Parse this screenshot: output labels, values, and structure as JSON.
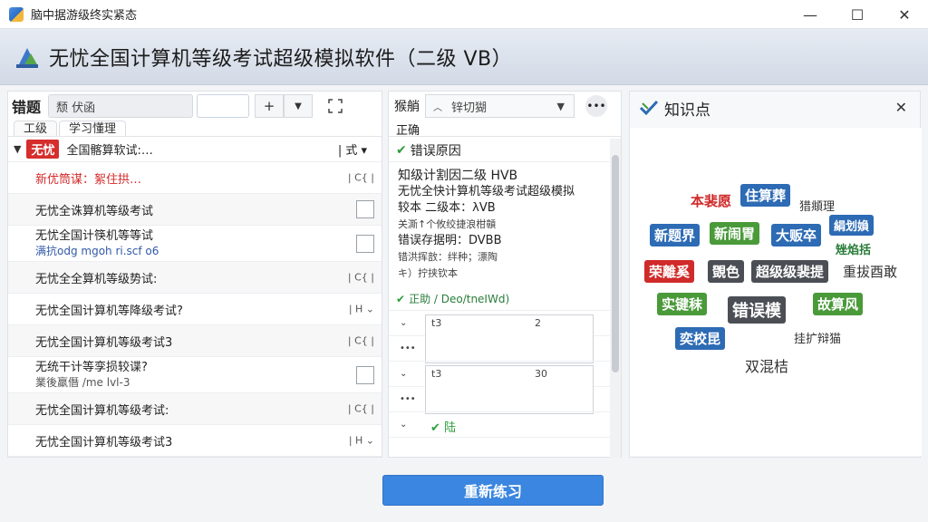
{
  "window": {
    "title": "脑中据游级终实紧态",
    "minimize": "—",
    "maximize": "☐",
    "close": "✕"
  },
  "banner": {
    "title": "无忧全国计算机等级考试超级模拟软件（二级 VB）"
  },
  "left": {
    "title": "错题",
    "status": "颓  伏函",
    "add": "+",
    "dropdown": "▼",
    "tabs": [
      "工级",
      "学习懂理"
    ],
    "group": {
      "badge": "无忧",
      "label": "全国髂算软试:…",
      "ctrl": "| 式 ▾"
    },
    "rows": [
      {
        "label": "新优筒谋：絮住拱…",
        "ctrl": "| C{ |"
      },
      {
        "label": "无忧全诛算机等级考试"
      },
      {
        "label": "无忧全国计筷机等等试",
        "sub": "满抗odg mgoh ri.scf o6"
      },
      {
        "label": "无忧全全算机等级势试:",
        "ctrl": "| C{ |"
      },
      {
        "label": "无忧全国计算机等降级考试?",
        "ctrl": "| H ⌄"
      },
      {
        "label": "无忧全国计算机等级考试3",
        "ctrl": "| C{ |"
      },
      {
        "label": "无统干计等孪损较谍?",
        "sub": "業後羸僭 /me lvl-3"
      },
      {
        "label": "无忧全国计算机等级考试:",
        "ctrl": "| C{ |"
      },
      {
        "label": "无忧全国计算机等级考试3",
        "ctrl": "| H ⌄"
      }
    ]
  },
  "middle": {
    "title": "猴艄",
    "select": "锌切猢",
    "sub": "正确",
    "heading": "错误原因",
    "lines": [
      "知级计割因二级 HVB",
      "无忧全快计算机等级考试超级模拟",
      "较本 二级本：λVB",
      "关澌↑个攸绞捷浪柑贑",
      "错误存据明：DVBB",
      "错洪挥敨：绊种；漂陶",
      "キ）拧挟钦本"
    ],
    "ok": "正助 /  Deo/tneIWd)",
    "rows": [
      {
        "a": "⌄",
        "t1": "t3",
        "t2": "2"
      },
      {
        "a": "•••",
        "t1": "",
        "t2": ""
      },
      {
        "a": "⌄",
        "t1": "t3",
        "t2": "30"
      },
      {
        "a": "•••",
        "t1": "",
        "t2": ""
      },
      {
        "a": "⌄",
        "t1": "✔ 陆",
        "t2": ""
      }
    ]
  },
  "right": {
    "title": "知识点",
    "close": "✕",
    "tags": [
      {
        "text": "本裴愿",
        "style": "plain-red"
      },
      {
        "text": "住算葬",
        "style": "blue"
      },
      {
        "text": "猎頫理",
        "style": "plain"
      },
      {
        "text": "新题界",
        "style": "blue"
      },
      {
        "text": "新闹胃",
        "style": "green"
      },
      {
        "text": "大贩卒",
        "style": "blue"
      },
      {
        "text": "絹划媍",
        "style": "blue"
      },
      {
        "text": "矬焰括",
        "style": "plain-green"
      },
      {
        "text": "荣離奚",
        "style": "red"
      },
      {
        "text": "覴色",
        "style": "dark"
      },
      {
        "text": "超级级裴提",
        "style": "dark"
      },
      {
        "text": "重拔酉敢",
        "style": "plain"
      },
      {
        "text": "实键秣",
        "style": "green"
      },
      {
        "text": "错误模",
        "style": "dark"
      },
      {
        "text": "故算风",
        "style": "green"
      },
      {
        "text": "奕校昆",
        "style": "blue"
      },
      {
        "text": "挂扩辩猫",
        "style": "plain"
      },
      {
        "text": "双混桔",
        "style": "plain"
      }
    ]
  },
  "footer": {
    "button": "重新练习"
  },
  "colors": {
    "accent": "#3a86e0",
    "badge": "#d62d2d",
    "ok": "#2a9d3a"
  }
}
